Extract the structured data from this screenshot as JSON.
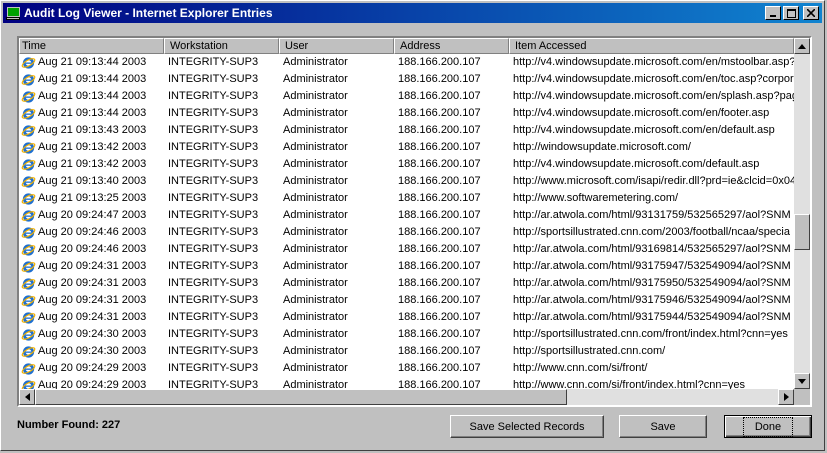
{
  "window": {
    "title": "Audit Log Viewer - Internet Explorer Entries",
    "controls": {
      "minimize": "_",
      "maximize": "□",
      "close": "✕"
    }
  },
  "table": {
    "columns": [
      "Time",
      "Workstation",
      "User",
      "Address",
      "Item Accessed"
    ],
    "row_icon": "internet-explorer-icon",
    "rows": [
      [
        "Aug 21 09:13:44 2003",
        "INTEGRITY-SUP3",
        "Administrator",
        "188.166.200.107",
        "http://v4.windowsupdate.microsoft.com/en/mstoolbar.asp?"
      ],
      [
        "Aug 21 09:13:44 2003",
        "INTEGRITY-SUP3",
        "Administrator",
        "188.166.200.107",
        "http://v4.windowsupdate.microsoft.com/en/toc.asp?corpor"
      ],
      [
        "Aug 21 09:13:44 2003",
        "INTEGRITY-SUP3",
        "Administrator",
        "188.166.200.107",
        "http://v4.windowsupdate.microsoft.com/en/splash.asp?pag"
      ],
      [
        "Aug 21 09:13:44 2003",
        "INTEGRITY-SUP3",
        "Administrator",
        "188.166.200.107",
        "http://v4.windowsupdate.microsoft.com/en/footer.asp"
      ],
      [
        "Aug 21 09:13:43 2003",
        "INTEGRITY-SUP3",
        "Administrator",
        "188.166.200.107",
        "http://v4.windowsupdate.microsoft.com/en/default.asp"
      ],
      [
        "Aug 21 09:13:42 2003",
        "INTEGRITY-SUP3",
        "Administrator",
        "188.166.200.107",
        "http://windowsupdate.microsoft.com/"
      ],
      [
        "Aug 21 09:13:42 2003",
        "INTEGRITY-SUP3",
        "Administrator",
        "188.166.200.107",
        "http://v4.windowsupdate.microsoft.com/default.asp"
      ],
      [
        "Aug 21 09:13:40 2003",
        "INTEGRITY-SUP3",
        "Administrator",
        "188.166.200.107",
        "http://www.microsoft.com/isapi/redir.dll?prd=ie&clcid=0x040"
      ],
      [
        "Aug 21 09:13:25 2003",
        "INTEGRITY-SUP3",
        "Administrator",
        "188.166.200.107",
        "http://www.softwaremetering.com/"
      ],
      [
        "Aug 20 09:24:47 2003",
        "INTEGRITY-SUP3",
        "Administrator",
        "188.166.200.107",
        "http://ar.atwola.com/html/93131759/532565297/aol?SNM"
      ],
      [
        "Aug 20 09:24:46 2003",
        "INTEGRITY-SUP3",
        "Administrator",
        "188.166.200.107",
        "http://sportsillustrated.cnn.com/2003/football/ncaa/specia"
      ],
      [
        "Aug 20 09:24:46 2003",
        "INTEGRITY-SUP3",
        "Administrator",
        "188.166.200.107",
        "http://ar.atwola.com/html/93169814/532565297/aol?SNM"
      ],
      [
        "Aug 20 09:24:31 2003",
        "INTEGRITY-SUP3",
        "Administrator",
        "188.166.200.107",
        "http://ar.atwola.com/html/93175947/532549094/aol?SNM"
      ],
      [
        "Aug 20 09:24:31 2003",
        "INTEGRITY-SUP3",
        "Administrator",
        "188.166.200.107",
        "http://ar.atwola.com/html/93175950/532549094/aol?SNM"
      ],
      [
        "Aug 20 09:24:31 2003",
        "INTEGRITY-SUP3",
        "Administrator",
        "188.166.200.107",
        "http://ar.atwola.com/html/93175946/532549094/aol?SNM"
      ],
      [
        "Aug 20 09:24:31 2003",
        "INTEGRITY-SUP3",
        "Administrator",
        "188.166.200.107",
        "http://ar.atwola.com/html/93175944/532549094/aol?SNM"
      ],
      [
        "Aug 20 09:24:30 2003",
        "INTEGRITY-SUP3",
        "Administrator",
        "188.166.200.107",
        "http://sportsillustrated.cnn.com/front/index.html?cnn=yes"
      ],
      [
        "Aug 20 09:24:30 2003",
        "INTEGRITY-SUP3",
        "Administrator",
        "188.166.200.107",
        "http://sportsillustrated.cnn.com/"
      ],
      [
        "Aug 20 09:24:29 2003",
        "INTEGRITY-SUP3",
        "Administrator",
        "188.166.200.107",
        "http://www.cnn.com/si/front/"
      ],
      [
        "Aug 20 09:24:29 2003",
        "INTEGRITY-SUP3",
        "Administrator",
        "188.166.200.107",
        "http://www.cnn.com/si/front/index.html?cnn=yes"
      ]
    ]
  },
  "footer": {
    "count_label": "Number Found:  227",
    "save_selected_label": "Save Selected Records",
    "save_label": "Save",
    "done_label": "Done"
  },
  "colors": {
    "titlebar": "#000080",
    "face": "#c0c0c0",
    "list_bg": "#ffffff"
  }
}
